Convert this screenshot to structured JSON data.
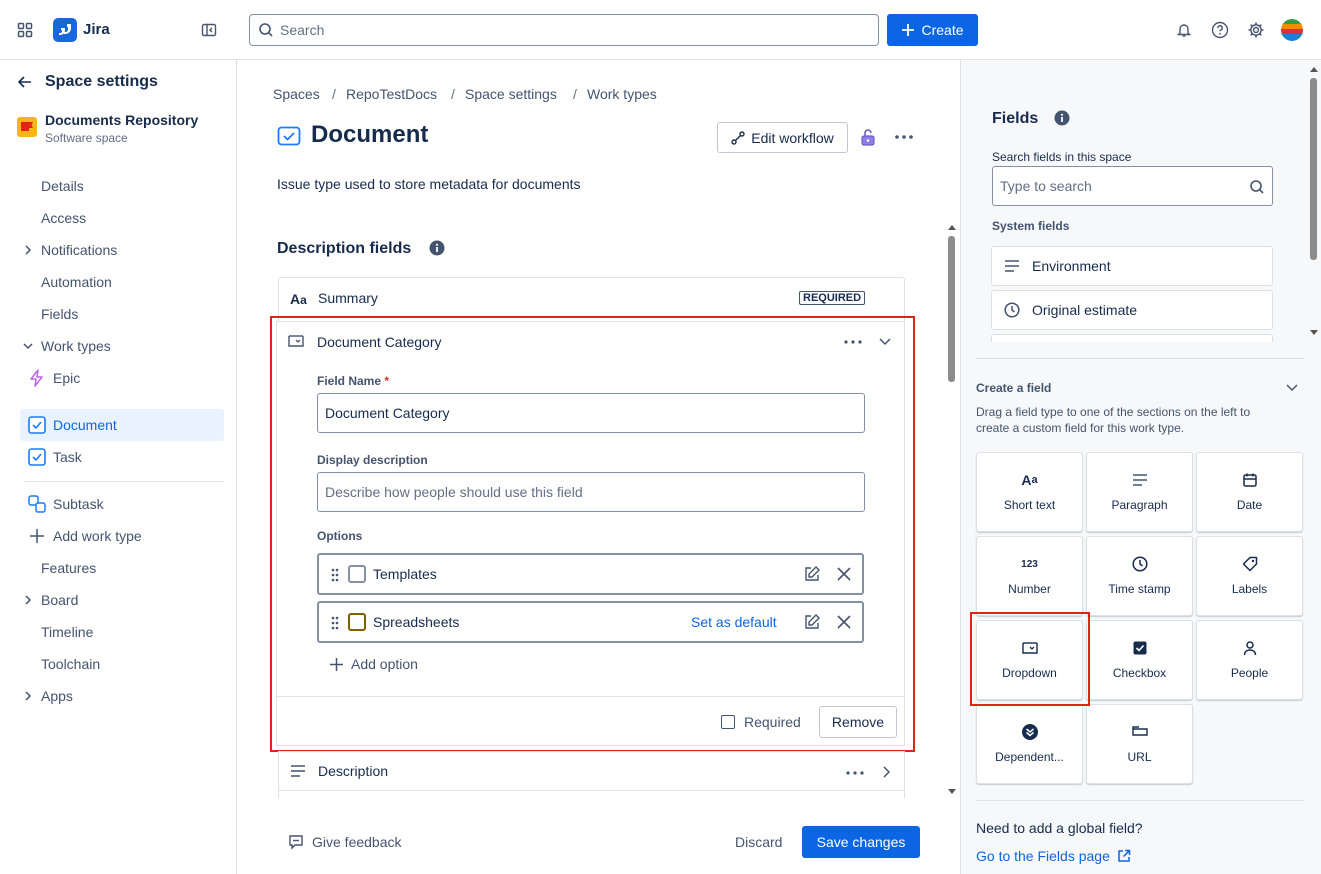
{
  "app": {
    "name": "Jira"
  },
  "topbar": {
    "search_placeholder": "Search",
    "create_label": "Create"
  },
  "sidebar": {
    "back_title": "Space settings",
    "space_name": "Documents Repository",
    "space_type": "Software space",
    "items": [
      "Details",
      "Access",
      "Notifications",
      "Automation",
      "Fields",
      "Work types"
    ],
    "work_types": [
      "Epic",
      "Document",
      "Task"
    ],
    "subtask": "Subtask",
    "add_work_type": "Add work type",
    "more_items": [
      "Features",
      "Board",
      "Timeline",
      "Toolchain",
      "Apps"
    ]
  },
  "breadcrumbs": [
    "Spaces",
    "RepoTestDocs",
    "Space settings",
    "Work types"
  ],
  "page": {
    "title": "Document",
    "description": "Issue type used to store metadata for documents",
    "edit_workflow": "Edit workflow",
    "section_title": "Description fields"
  },
  "fields": {
    "summary": {
      "name": "Summary",
      "badge": "REQUIRED"
    },
    "category": {
      "name": "Document Category",
      "field_name_label": "Field Name",
      "required_mark": "*",
      "field_name_value": "Document Category",
      "display_desc_label": "Display description",
      "display_desc_placeholder": "Describe how people should use this field",
      "options_label": "Options",
      "options": [
        "Templates",
        "Spreadsheets"
      ],
      "set_default": "Set as default",
      "add_option": "Add option",
      "required_label": "Required",
      "remove_label": "Remove"
    },
    "description": {
      "name": "Description"
    }
  },
  "footer": {
    "feedback": "Give feedback",
    "discard": "Discard",
    "save": "Save changes"
  },
  "right_panel": {
    "title": "Fields",
    "search_label": "Search fields in this space",
    "search_placeholder": "Type to search",
    "system_fields_label": "System fields",
    "system_fields": [
      "Environment",
      "Original estimate"
    ],
    "create_title": "Create a field",
    "create_desc_1": "Drag a field type to one of the sections on the left to",
    "create_desc_2": "create a custom field for this work type.",
    "tiles": [
      "Short text",
      "Paragraph",
      "Date",
      "Number",
      "Time stamp",
      "Labels",
      "Dropdown",
      "Checkbox",
      "People",
      "Dependent...",
      "URL"
    ],
    "global_question": "Need to add a global field?",
    "global_link": "Go to the Fields page"
  },
  "colors": {
    "primary": "#0c66e4",
    "highlight": "#e2231a",
    "selected_bg": "#e9f2ff"
  }
}
